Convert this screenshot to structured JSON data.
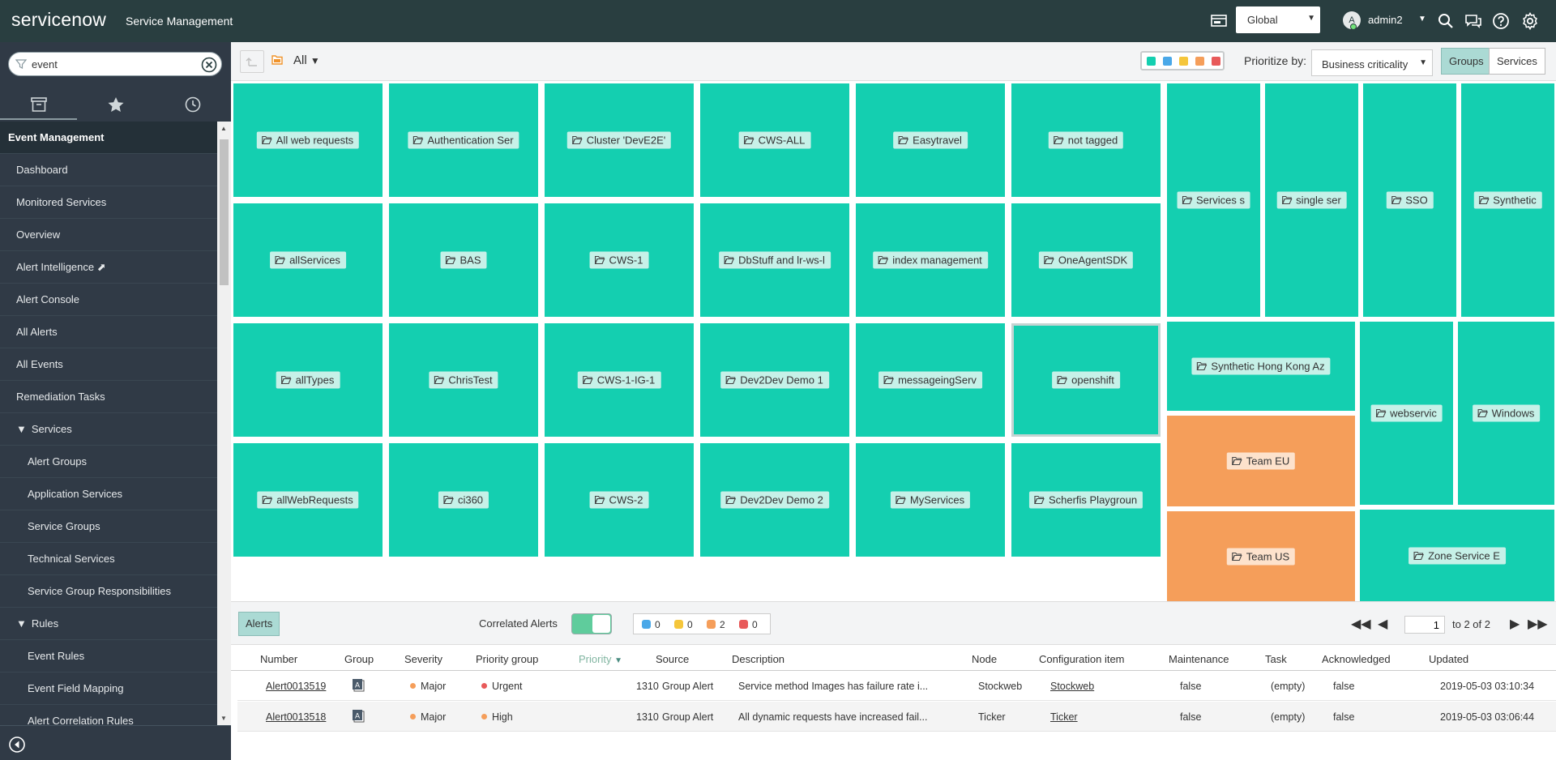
{
  "header": {
    "logo_text": "servicenow",
    "product_title": "Service Management",
    "scope": "Global",
    "user_initial": "A",
    "username": "admin2"
  },
  "nav": {
    "filter_value": "event",
    "module": "Event Management",
    "items": [
      {
        "label": "Dashboard",
        "level": 1
      },
      {
        "label": "Monitored Services",
        "level": 1
      },
      {
        "label": "Overview",
        "level": 1
      },
      {
        "label": "Alert Intelligence ⬈",
        "level": 1
      },
      {
        "label": "Alert Console",
        "level": 1
      },
      {
        "label": "All Alerts",
        "level": 1
      },
      {
        "label": "All Events",
        "level": 1
      },
      {
        "label": "Remediation Tasks",
        "level": 1
      },
      {
        "label": "Services",
        "level": 1,
        "section": true
      },
      {
        "label": "Alert Groups",
        "level": 2
      },
      {
        "label": "Application Services",
        "level": 2
      },
      {
        "label": "Service Groups",
        "level": 2
      },
      {
        "label": "Technical Services",
        "level": 2
      },
      {
        "label": "Service Group Responsibilities",
        "level": 2
      },
      {
        "label": "Rules",
        "level": 1,
        "section": true
      },
      {
        "label": "Event Rules",
        "level": 2
      },
      {
        "label": "Event Field Mapping",
        "level": 2
      },
      {
        "label": "Alert Correlation Rules",
        "level": 2
      }
    ]
  },
  "toolbar": {
    "filter_label": "All",
    "prioritize_label": "Prioritize by:",
    "prioritize_value": "Business criticality",
    "groups_label": "Groups",
    "services_label": "Services",
    "severity_colors": [
      "#14cfb0",
      "#4aa8e8",
      "#f5c63b",
      "#f59e5a",
      "#e85a5a"
    ]
  },
  "treemap": {
    "tiles": [
      {
        "label": "All web requests",
        "color": "green"
      },
      {
        "label": "Authentication Ser",
        "color": "green"
      },
      {
        "label": "Cluster 'DevE2E'",
        "color": "green"
      },
      {
        "label": "CWS-ALL",
        "color": "green"
      },
      {
        "label": "Easytravel",
        "color": "green"
      },
      {
        "label": "not tagged",
        "color": "green"
      },
      {
        "label": "Services s",
        "color": "green"
      },
      {
        "label": "single ser",
        "color": "green"
      },
      {
        "label": "SSO",
        "color": "green"
      },
      {
        "label": "Synthetic",
        "color": "green"
      },
      {
        "label": "allServices",
        "color": "green"
      },
      {
        "label": "BAS",
        "color": "green"
      },
      {
        "label": "CWS-1",
        "color": "green"
      },
      {
        "label": "DbStuff and lr-ws-l",
        "color": "green"
      },
      {
        "label": "index management",
        "color": "green"
      },
      {
        "label": "OneAgentSDK",
        "color": "green"
      },
      {
        "label": "Synthetic Hong Kong Az",
        "color": "green"
      },
      {
        "label": "webservic",
        "color": "green"
      },
      {
        "label": "Windows",
        "color": "green"
      },
      {
        "label": "allTypes",
        "color": "green"
      },
      {
        "label": "ChrisTest",
        "color": "green"
      },
      {
        "label": "CWS-1-IG-1",
        "color": "green"
      },
      {
        "label": "Dev2Dev Demo 1",
        "color": "green"
      },
      {
        "label": "messageingServ",
        "color": "green"
      },
      {
        "label": "openshift",
        "color": "green"
      },
      {
        "label": "Team EU",
        "color": "orange"
      },
      {
        "label": "allWebRequests",
        "color": "green"
      },
      {
        "label": "ci360",
        "color": "green"
      },
      {
        "label": "CWS-2",
        "color": "green"
      },
      {
        "label": "Dev2Dev Demo 2",
        "color": "green"
      },
      {
        "label": "MyServices",
        "color": "green"
      },
      {
        "label": "Scherfis Playgroun",
        "color": "green"
      },
      {
        "label": "Team US",
        "color": "orange"
      },
      {
        "label": "Zone Service E",
        "color": "green"
      }
    ]
  },
  "alerts_bar": {
    "alerts_label": "Alerts",
    "correlated_label": "Correlated Alerts",
    "counts": [
      {
        "color": "#4aa8e8",
        "value": "0"
      },
      {
        "color": "#f5c63b",
        "value": "0"
      },
      {
        "color": "#f59e5a",
        "value": "2"
      },
      {
        "color": "#e85a5a",
        "value": "0"
      }
    ],
    "page_value": "1",
    "page_text": "to 2 of 2"
  },
  "table": {
    "columns": [
      "Number",
      "Group",
      "Severity",
      "Priority group",
      "Priority",
      "Source",
      "Description",
      "Node",
      "Configuration item",
      "Maintenance",
      "Task",
      "Acknowledged",
      "Updated"
    ],
    "rows": [
      {
        "number": "Alert0013519",
        "group_icon": "alert-group-icon",
        "severity": "Major",
        "severity_color": "#f59e5a",
        "priority_group": "Urgent",
        "priority_group_color": "#e85a5a",
        "priority": "1310",
        "source": "Group Alert",
        "description": "Service method Images has failure rate i...",
        "node": "Stockweb",
        "ci": "Stockweb",
        "maintenance": "false",
        "task": "(empty)",
        "acknowledged": "false",
        "updated": "2019-05-03 03:10:34"
      },
      {
        "number": "Alert0013518",
        "group_icon": "alert-group-icon",
        "severity": "Major",
        "severity_color": "#f59e5a",
        "priority_group": "High",
        "priority_group_color": "#f59e5a",
        "priority": "1310",
        "source": "Group Alert",
        "description": "All dynamic requests have increased fail...",
        "node": "Ticker",
        "ci": "Ticker",
        "maintenance": "false",
        "task": "(empty)",
        "acknowledged": "false",
        "updated": "2019-05-03 03:06:44"
      }
    ]
  }
}
